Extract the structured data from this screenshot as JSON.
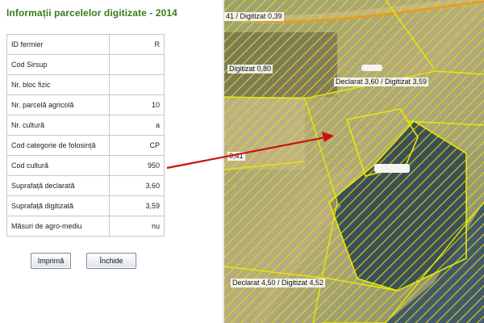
{
  "panel": {
    "title": "Informații parcelelor digitizate - 2014",
    "rows": [
      {
        "label": "ID fermier",
        "value": "R"
      },
      {
        "label": "Cod Sirsup",
        "value": ""
      },
      {
        "label": "Nr. bloc fizic",
        "value": ""
      },
      {
        "label": "Nr. parcelă agricolă",
        "value": "10"
      },
      {
        "label": "Nr. cultură",
        "value": "a"
      },
      {
        "label": "Cod categorie de folosință",
        "value": "CP"
      },
      {
        "label": "Cod cultură",
        "value": "950"
      },
      {
        "label": "Suprafață declarată",
        "value": "3,60"
      },
      {
        "label": "Suprafață digitizată",
        "value": "3,59"
      },
      {
        "label": "Măsuri de agro-mediu",
        "value": "nu"
      }
    ],
    "buttons": {
      "print": "Imprimă",
      "close": "Închide"
    }
  },
  "map": {
    "labels": {
      "top": "41 / Digitizat 0,39",
      "digitizat": "Digitizat 0,80",
      "main": "Declarat 3,60 / Digitizat 3,59",
      "left": "0,41",
      "bottom": "Declarat 4,50 / Digitizat 4,52"
    }
  },
  "colors": {
    "title": "#3a7a1c",
    "parcel_outline": "#e8e800",
    "hatch": "#d8d800",
    "arrow": "#cc1111"
  }
}
